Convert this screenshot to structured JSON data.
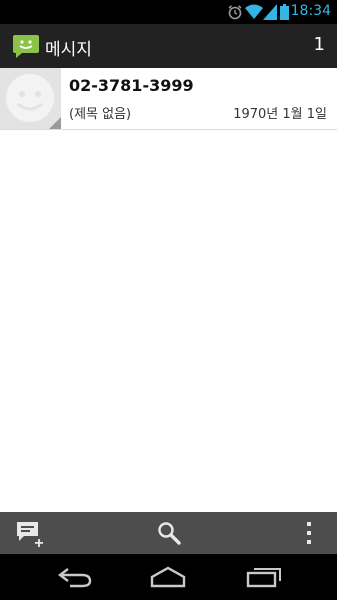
{
  "status_bar": {
    "time": "18:34",
    "icons": [
      "alarm-icon",
      "wifi-icon",
      "signal-icon",
      "battery-icon"
    ]
  },
  "action_bar": {
    "title": "메시지",
    "count": "1",
    "icon": "messaging-app-icon"
  },
  "conversations": [
    {
      "sender": "02-3781-3999",
      "subject": "(제목 없음)",
      "date": "1970년 1월 1일",
      "avatar": "default-contact-avatar"
    }
  ],
  "bottom_bar": {
    "buttons": [
      "compose-icon",
      "search-icon",
      "overflow-menu-icon"
    ]
  },
  "nav_bar": {
    "buttons": [
      "back-icon",
      "home-icon",
      "recent-apps-icon"
    ]
  },
  "colors": {
    "status_accent": "#33b5e5",
    "action_bar_bg": "#222222",
    "bottom_bar_bg": "#4d4d4d",
    "app_icon_green": "#8bc34a"
  }
}
